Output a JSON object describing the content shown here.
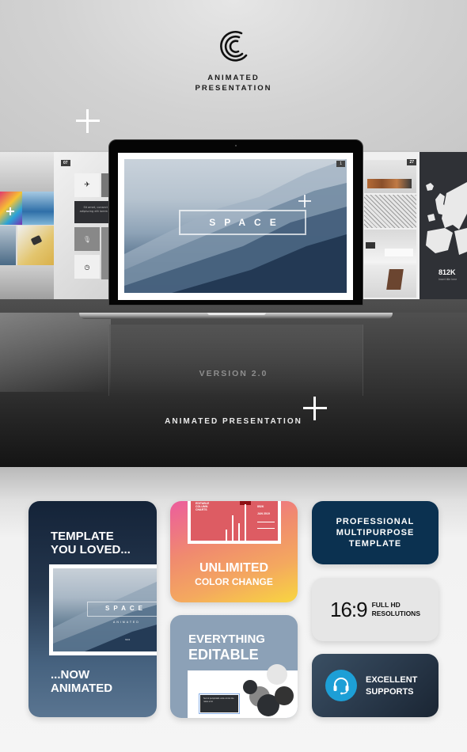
{
  "hero": {
    "logo_icon": "concentric-c-logo-icon",
    "logo_caption_line1": "ANIMATED",
    "logo_caption_line2": "PRESENTATION",
    "version": "VERSION 2.0",
    "tagline": "ANIMATED PRESENTATION",
    "laptop_slide": {
      "title": "SPACE",
      "slide_number": "1"
    },
    "side_slides": {
      "icons_slide_number": "07",
      "icons_slide_text": "Sit amet, consect adipiscing elit lorem",
      "interior_slide_number": "27",
      "map_stat": "812K",
      "map_caption": "Insert title here"
    }
  },
  "cards": {
    "animated": {
      "line1": "TEMPLATE",
      "line2": "YOU LOVED...",
      "line3": "...NOW",
      "line4": "ANIMATED",
      "mini_title": "SPACE",
      "mini_subtitle": "ANIMATED",
      "mini_version": "V2.0"
    },
    "color": {
      "line1": "UNLIMITED",
      "line2": "COLOR CHANGE",
      "slide_label": "EDITABLE COLUMN CHARTS",
      "stat1": "852K",
      "stat2": "JAN 2019"
    },
    "editable": {
      "line1": "EVERYTHING",
      "line2": "EDITABLE",
      "box_text": "Sed ut perspiciatis unde omnis iste natus error"
    },
    "professional": {
      "line1": "PROFESSIONAL",
      "line2": "MULTIPURPOSE",
      "line3": "TEMPLATE"
    },
    "hd": {
      "ratio": "16:9",
      "line1": "FULL HD",
      "line2": "RESOLUTIONS"
    },
    "support": {
      "icon": "headset-icon",
      "line1": "EXCELLENT",
      "line2": "SUPPORTS",
      "accent_color": "#1d9fd6"
    }
  },
  "colors": {
    "navy": "#0b3150",
    "dark_slate": "#142338",
    "coral": "#dd5c63",
    "slate_blue": "#8ca1b7"
  }
}
